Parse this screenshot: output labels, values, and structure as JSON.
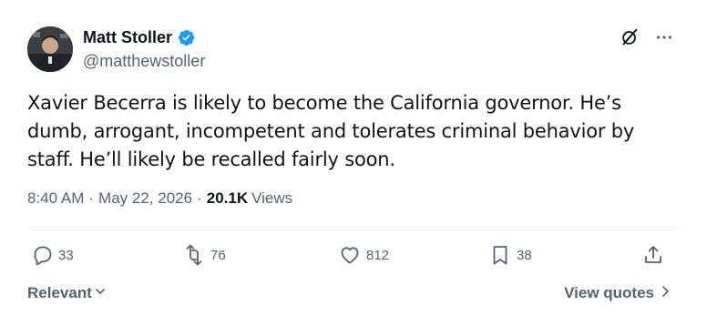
{
  "author": {
    "display_name": "Matt Stoller",
    "handle": "@matthewstoller",
    "verified": true,
    "verified_color": "#1d9bf0"
  },
  "tweet": {
    "text": "Xavier Becerra is likely to become the California governor. He’s dumb, arrogant, incompetent and tolerates criminal behavior by staff. He’ll likely be recalled fairly soon.",
    "time": "8:40 AM",
    "date": "May 22, 2026",
    "views_count": "20.1K",
    "views_label": "Views"
  },
  "icons": {
    "top": [
      "grok-icon",
      "more-icon"
    ],
    "actions": [
      "reply-icon",
      "repost-icon",
      "like-icon",
      "bookmark-icon",
      "share-icon"
    ]
  },
  "actions": {
    "reply_count": "33",
    "repost_count": "76",
    "like_count": "812",
    "bookmark_count": "38"
  },
  "footer": {
    "sort_label": "Relevant",
    "view_quotes_label": "View quotes"
  },
  "colors": {
    "text": "#0f1419",
    "muted": "#536471",
    "divider": "#eff3f4"
  }
}
